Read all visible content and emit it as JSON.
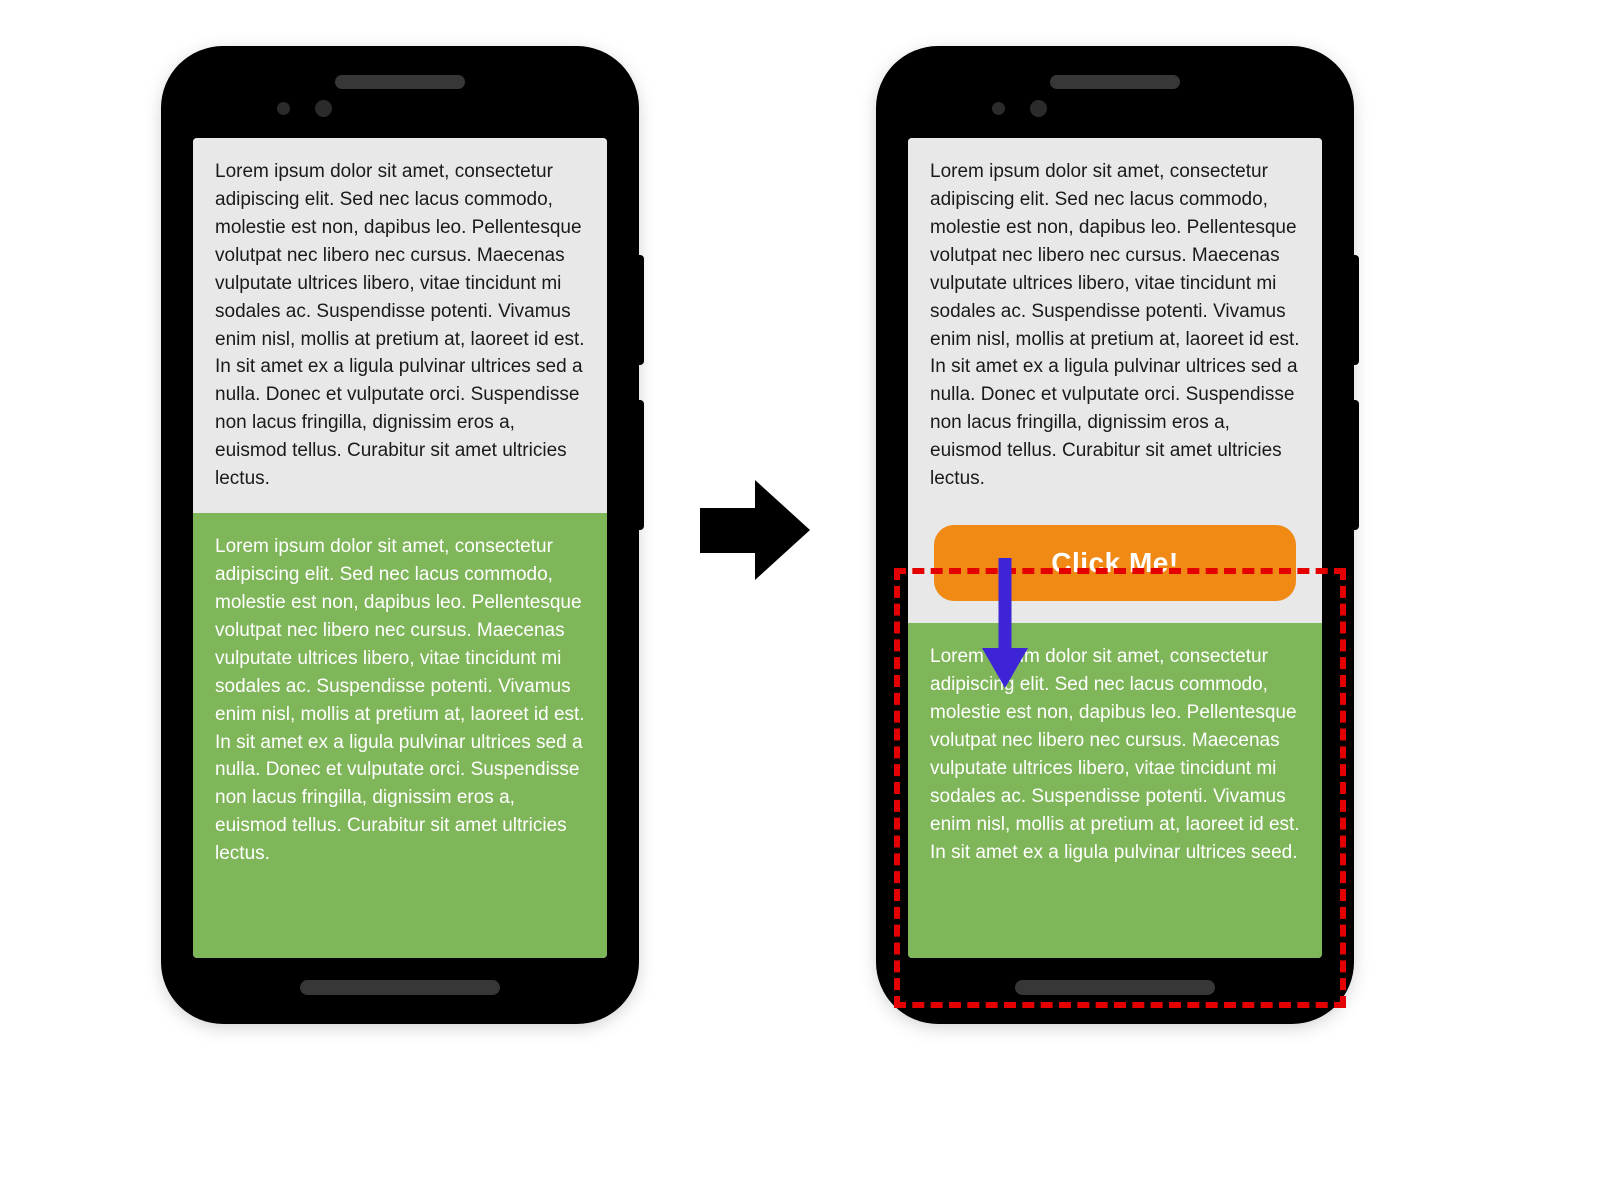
{
  "phones": {
    "left": {
      "block1_text": "Lorem ipsum dolor sit amet, consectetur adipiscing elit. Sed nec lacus commodo, molestie est non, dapibus leo. Pellentesque volutpat nec libero nec cursus. Maecenas vulputate ultrices libero, vitae tincidunt mi sodales ac. Suspendisse potenti. Vivamus enim nisl, mollis at pretium at, laoreet id est. In sit amet ex a ligula pulvinar ultrices sed a nulla. Donec et vulputate orci. Suspendisse non lacus fringilla, dignissim eros a, euismod tellus. Curabitur sit amet ultricies lectus.",
      "block2_text": "Lorem ipsum dolor sit amet, consectetur adipiscing elit. Sed nec lacus commodo, molestie est non, dapibus leo. Pellentesque volutpat nec libero nec cursus. Maecenas vulputate ultrices libero, vitae tincidunt mi sodales ac. Suspendisse potenti. Vivamus enim nisl, mollis at pretium at, laoreet id est. In sit amet ex a ligula pulvinar ultrices sed a nulla. Donec et vulputate orci. Suspendisse non lacus fringilla, dignissim eros a, euismod tellus. Curabitur sit amet ultricies lectus."
    },
    "right": {
      "block1_text": "Lorem ipsum dolor sit amet, consectetur adipiscing elit. Sed nec lacus commodo, molestie est non, dapibus leo. Pellentesque volutpat nec libero nec cursus. Maecenas vulputate ultrices libero, vitae tincidunt mi sodales ac. Suspendisse potenti. Vivamus enim nisl, mollis at pretium at, laoreet id est. In sit amet ex a ligula pulvinar ultrices sed a nulla. Donec et vulputate orci. Suspendisse non lacus fringilla, dignissim eros a, euismod tellus. Curabitur sit amet ultricies lectus.",
      "button_label": "Click Me!",
      "block2_text": "Lorem ipsum dolor sit amet, consectetur adipiscing elit. Sed nec lacus commodo, molestie est non, dapibus leo. Pellentesque volutpat nec libero nec cursus. Maecenas vulputate ultrices libero, vitae tincidunt mi sodales ac. Suspendisse potenti. Vivamus enim nisl, mollis at pretium at, laoreet id est. In sit amet ex a ligula pulvinar ultrices seed."
    }
  },
  "colors": {
    "phone_frame": "#000000",
    "screen_bg": "#e8e8e8",
    "green_block": "#80b65a",
    "button_bg": "#f08a15",
    "highlight_border": "#e40000",
    "down_arrow": "#3d24d6",
    "transition_arrow": "#000000"
  }
}
